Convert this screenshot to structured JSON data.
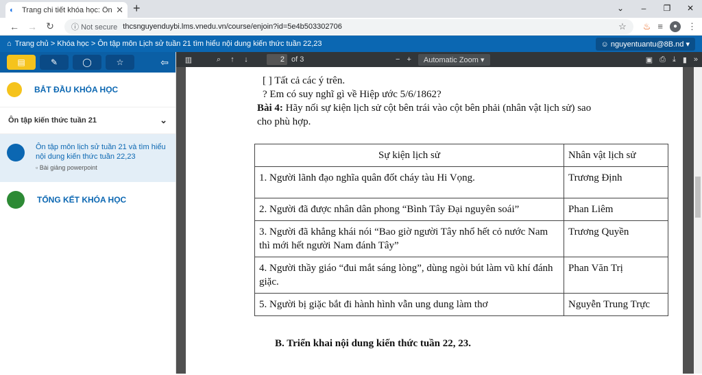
{
  "browser": {
    "tab_title": "Trang chi tiết khóa học: Ôn tập m",
    "new_tab": "+",
    "not_secure": "Not secure",
    "url": "thcsnguyenduybi.lms.vnedu.vn/course/enjoin?id=5e4b503302706"
  },
  "site": {
    "breadcrumb": "Trang chủ  >  Khóa học  >  Ôn tập môn Lịch sử tuần 21 tìm hiểu nội dung kiến thức tuần 22,23",
    "user": "nguyentuantu@8B.nd"
  },
  "sidebar": {
    "start": "BẮT ĐẦU KHÓA HỌC",
    "section": "Ôn tập kiến thức tuần 21",
    "lesson_title": "Ôn tập môn lịch sử tuần 21 và tìm hiểu nội dung kiến thức tuần 22,23",
    "lesson_type": "Bài giảng powerpoint",
    "end": "TỔNG KẾT KHÓA HỌC"
  },
  "pdf": {
    "page": "2",
    "of": "of 3",
    "zoom": "Automatic Zoom"
  },
  "doc": {
    "line1": "[  ] Tất cả các ý trên.",
    "line2": "? Em có suy nghĩ gì về Hiệp ước 5/6/1862?",
    "bai4_bold": "Bài 4:",
    "bai4": " Hãy nối sự kiện lịch sử cột bên trái vào cột bên phải (nhân vật lịch sử) sao",
    "bai4_2": "cho phù hợp.",
    "table": {
      "h1": "Sự kiện lịch sử",
      "h2": "Nhân vật lịch sử",
      "rows": [
        {
          "e": "1. Người lãnh đạo nghĩa quân đốt cháy tàu Hi Vọng.",
          "p": "Trương Định"
        },
        {
          "e": "2. Người đã được nhân dân phong “Bình Tây Đại nguyên soái”",
          "p": "Phan Liêm"
        },
        {
          "e": "3. Người đã khẳng khái nói “Bao giờ người Tây nhổ hết cỏ nước Nam thì mới hết người Nam đánh Tây”",
          "p": "Trương Quyền"
        },
        {
          "e": "4. Người thầy giáo “đui mắt sáng lòng”, dùng ngòi bút làm vũ khí đánh giặc.",
          "p": "Phan Văn Trị"
        },
        {
          "e": "5. Người bị giặc bắt đi hành hình vẫn ung dung làm thơ",
          "p": "Nguyễn Trung Trực"
        }
      ]
    },
    "sectionB": "B.  Triển khai nội dung kiến thức tuần 22, 23."
  }
}
